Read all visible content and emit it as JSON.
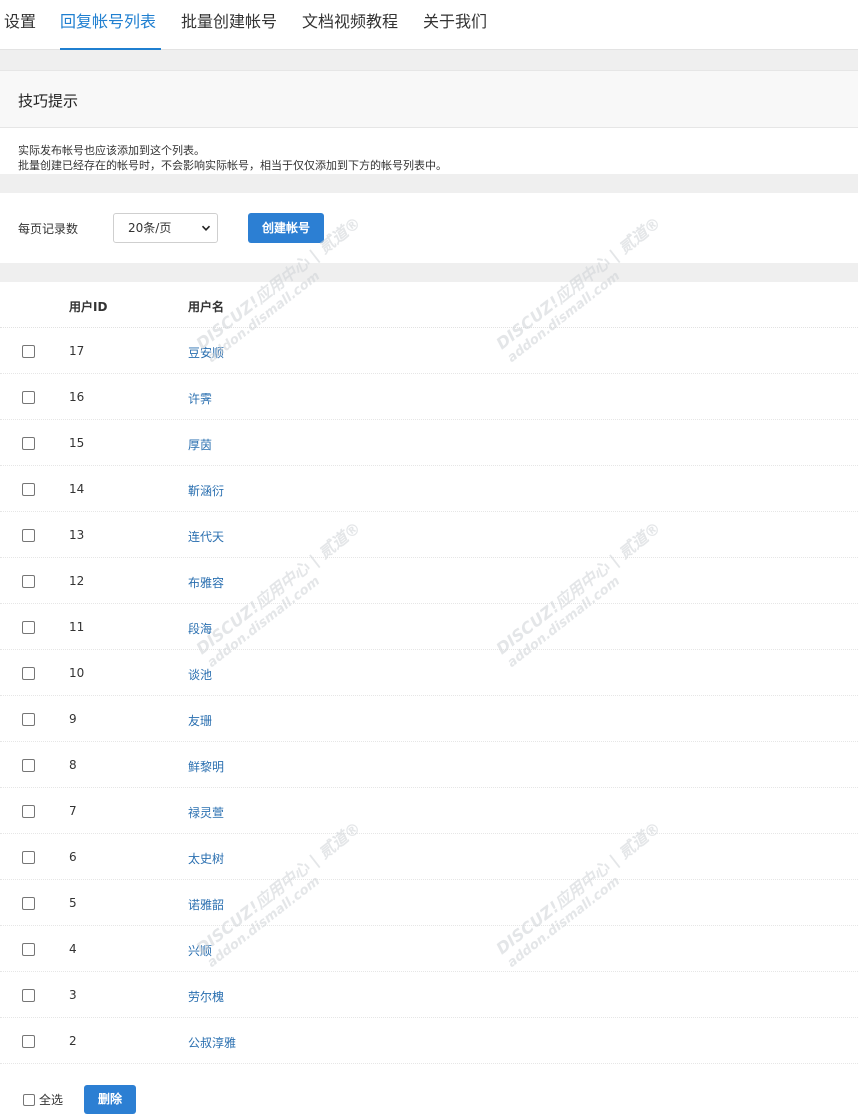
{
  "tabs": [
    {
      "label": "设置",
      "active": false
    },
    {
      "label": "回复帐号列表",
      "active": true
    },
    {
      "label": "批量创建帐号",
      "active": false
    },
    {
      "label": "文档视频教程",
      "active": false
    },
    {
      "label": "关于我们",
      "active": false
    }
  ],
  "tips": {
    "title": "技巧提示",
    "lines": [
      "实际发布帐号也应该添加到这个列表。",
      "批量创建已经存在的帐号时，不会影响实际帐号，相当于仅仅添加到下方的帐号列表中。"
    ]
  },
  "controls": {
    "per_page_label": "每页记录数",
    "per_page_value": "20条/页",
    "create_button": "创建帐号"
  },
  "table": {
    "headers": {
      "id": "用户ID",
      "name": "用户名"
    },
    "rows": [
      {
        "id": "17",
        "name": "豆安顺"
      },
      {
        "id": "16",
        "name": "许霁"
      },
      {
        "id": "15",
        "name": "厚茵"
      },
      {
        "id": "14",
        "name": "靳涵衍"
      },
      {
        "id": "13",
        "name": "连代天"
      },
      {
        "id": "12",
        "name": "布雅容"
      },
      {
        "id": "11",
        "name": "段海"
      },
      {
        "id": "10",
        "name": "谈池"
      },
      {
        "id": "9",
        "name": "友珊"
      },
      {
        "id": "8",
        "name": "鲜黎明"
      },
      {
        "id": "7",
        "name": "禄灵萱"
      },
      {
        "id": "6",
        "name": "太史树"
      },
      {
        "id": "5",
        "name": "诺雅韶"
      },
      {
        "id": "4",
        "name": "兴顺"
      },
      {
        "id": "3",
        "name": "劳尔槐"
      },
      {
        "id": "2",
        "name": "公叔淳雅"
      }
    ]
  },
  "footer": {
    "select_all_label": "全选",
    "delete_button": "删除"
  },
  "watermark": {
    "brand": "DISCUZ!应用中心 | 贰道®",
    "url": "addon.dismall.com"
  },
  "colors": {
    "accent": "#1f7fd0",
    "button": "#2c7fd3",
    "link": "#2a6fb0"
  }
}
